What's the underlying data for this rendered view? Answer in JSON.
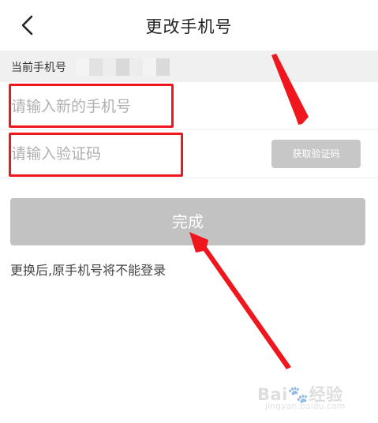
{
  "header": {
    "title": "更改手机号",
    "back_icon": "back-chevron-icon"
  },
  "current_phone": {
    "label": "当前手机号",
    "masked_colors": [
      "#f4f4f4",
      "#e2e2e2",
      "#ededed",
      "#d9d9d9",
      "#ececec",
      "#f3f3f3",
      "#dadada"
    ]
  },
  "form": {
    "new_phone_placeholder": "请输入新的手机号",
    "new_phone_value": "",
    "code_placeholder": "请输入验证码",
    "code_value": "",
    "get_code_label": "获取验证码",
    "complete_label": "完成"
  },
  "hint": {
    "text": "更换后,原手机号将不能登录"
  },
  "annotation": {
    "color": "#f0161e"
  },
  "watermark": {
    "text": "Bai🐾经验",
    "url": "jingyan.baidu.com"
  }
}
